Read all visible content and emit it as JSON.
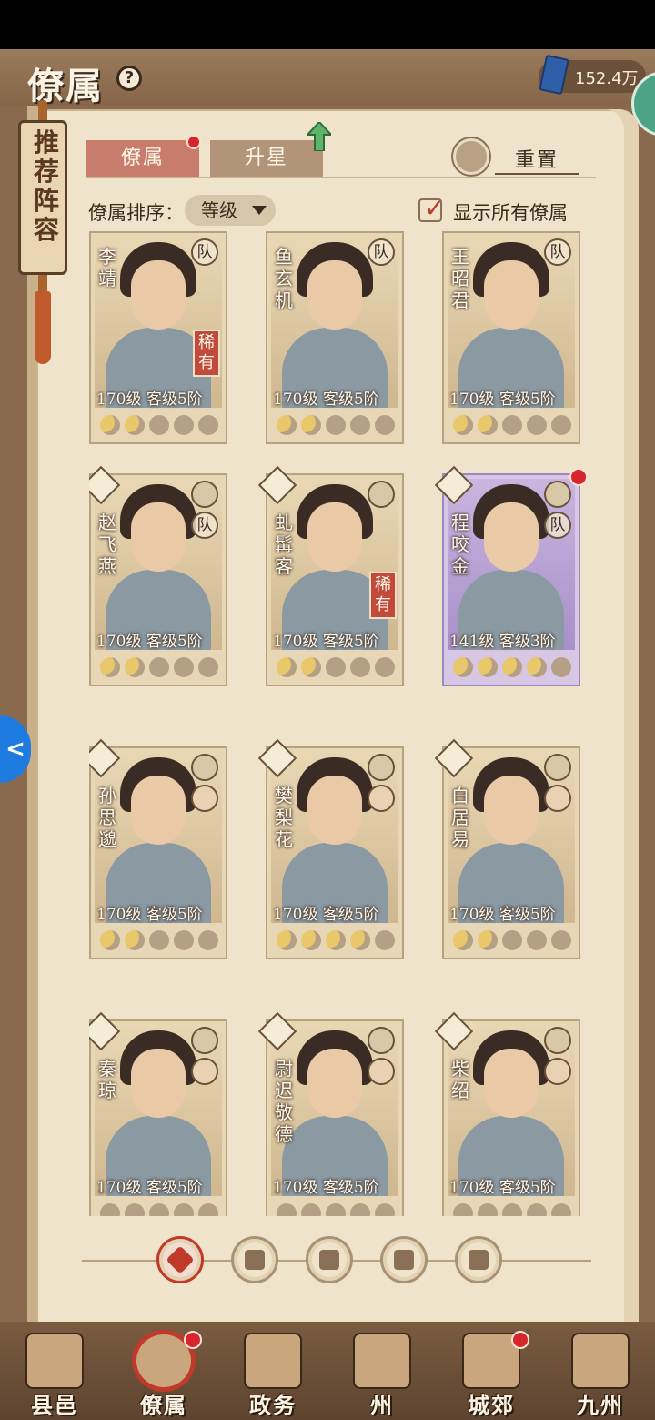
{
  "header": {
    "title": "僚属",
    "currency_value": "152.4万"
  },
  "banner": {
    "text": "推荐阵容"
  },
  "tabs": [
    {
      "label": "僚属",
      "active": true,
      "red_dot": true
    },
    {
      "label": "升星",
      "active": false,
      "red_dot": false
    }
  ],
  "reset_label": "重置",
  "sort": {
    "label": "僚属排序：",
    "selected": "等级"
  },
  "show_all": {
    "label": "显示所有僚属",
    "checked": true
  },
  "cards": [
    {
      "name": "李靖",
      "stats": "170级  客级5阶",
      "team": "队",
      "rare": "稀有",
      "stars_on": 2,
      "stars_total": 5,
      "purple": false,
      "red_dot": false
    },
    {
      "name": "鱼玄机",
      "stats": "170级  客级5阶",
      "team": "队",
      "rare": "",
      "stars_on": 2,
      "stars_total": 5,
      "purple": false,
      "red_dot": false
    },
    {
      "name": "王昭君",
      "stats": "170级  客级5阶",
      "team": "队",
      "rare": "",
      "stars_on": 2,
      "stars_total": 5,
      "purple": false,
      "red_dot": false
    },
    {
      "name": "赵飞燕",
      "stats": "170级  客级5阶",
      "team": "队",
      "rare": "",
      "stars_on": 2,
      "stars_total": 5,
      "purple": false,
      "red_dot": false
    },
    {
      "name": "虬髯客",
      "stats": "170级  客级5阶",
      "team": "",
      "rare": "稀有",
      "stars_on": 2,
      "stars_total": 5,
      "purple": false,
      "red_dot": false
    },
    {
      "name": "程咬金",
      "stats": "141级  客级3阶",
      "team": "队",
      "rare": "",
      "stars_on": 4,
      "stars_total": 5,
      "purple": true,
      "red_dot": true
    },
    {
      "name": "孙思邈",
      "stats": "170级  客级5阶",
      "team": "",
      "rare": "",
      "stars_on": 2,
      "stars_total": 5,
      "purple": false,
      "red_dot": false
    },
    {
      "name": "樊梨花",
      "stats": "170级  客级5阶",
      "team": "",
      "rare": "",
      "stars_on": 4,
      "stars_total": 5,
      "purple": false,
      "red_dot": false
    },
    {
      "name": "白居易",
      "stats": "170级  客级5阶",
      "team": "",
      "rare": "",
      "stars_on": 2,
      "stars_total": 5,
      "purple": false,
      "red_dot": false
    },
    {
      "name": "秦琼",
      "stats": "170级  客级5阶",
      "team": "",
      "rare": "",
      "stars_on": 0,
      "stars_total": 5,
      "purple": false,
      "red_dot": false
    },
    {
      "name": "尉迟敬德",
      "stats": "170级  客级5阶",
      "team": "",
      "rare": "",
      "stars_on": 0,
      "stars_total": 5,
      "purple": false,
      "red_dot": false
    },
    {
      "name": "柴绍",
      "stats": "170级  客级5阶",
      "team": "",
      "rare": "",
      "stars_on": 0,
      "stars_total": 5,
      "purple": false,
      "red_dot": false
    }
  ],
  "filters": [
    {
      "icon": "all-diamond-icon",
      "active": true
    },
    {
      "icon": "crown-icon",
      "active": false
    },
    {
      "icon": "cat-icon",
      "active": false
    },
    {
      "icon": "fan-icon",
      "active": false
    },
    {
      "icon": "horse-icon",
      "active": false
    }
  ],
  "bottom_nav": [
    {
      "label": "县邑",
      "active": false,
      "red_dot": false
    },
    {
      "label": "僚属",
      "active": true,
      "red_dot": true
    },
    {
      "label": "政务",
      "active": false,
      "red_dot": false
    },
    {
      "label": "州",
      "active": false,
      "red_dot": false
    },
    {
      "label": "城郊",
      "active": false,
      "red_dot": true
    },
    {
      "label": "九州",
      "active": false,
      "red_dot": false
    }
  ]
}
